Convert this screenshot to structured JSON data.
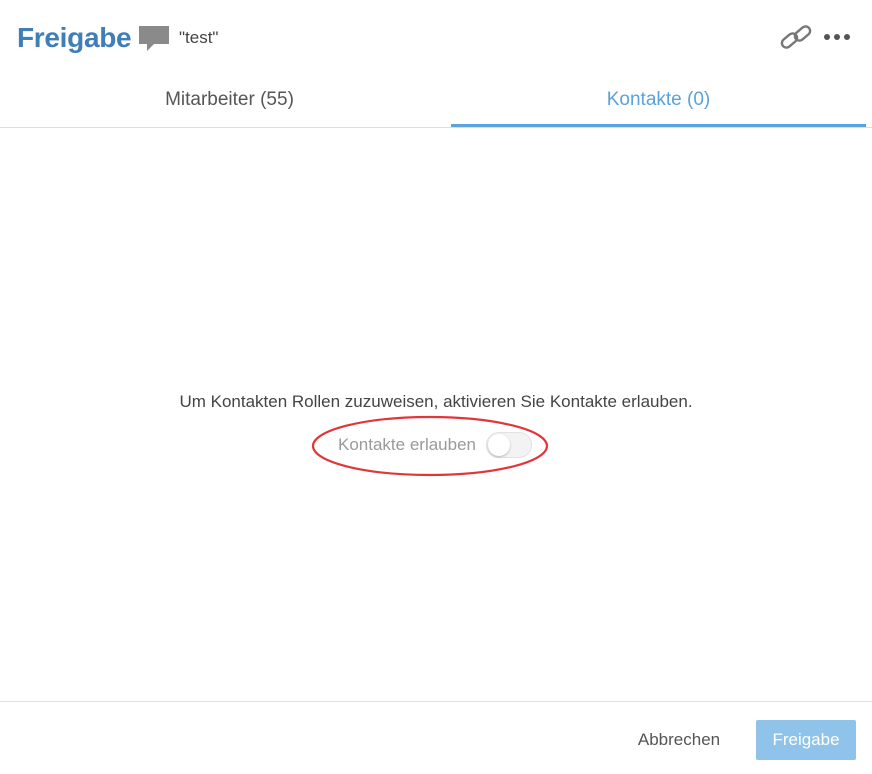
{
  "header": {
    "title": "Freigabe",
    "item_name": "\"test\"",
    "icons": {
      "item_type": "comment-icon",
      "share_link": "link-icon",
      "more": "more-dots-icon"
    }
  },
  "tabs": [
    {
      "label": "Mitarbeiter (55)",
      "active": false
    },
    {
      "label": "Kontakte (0)",
      "active": true
    }
  ],
  "main": {
    "message": "Um Kontakten Rollen zuzuweisen, aktivieren Sie Kontakte erlauben.",
    "toggle": {
      "label": "Kontakte erlauben",
      "enabled": false
    }
  },
  "footer": {
    "cancel_label": "Abbrechen",
    "share_label": "Freigabe"
  },
  "colors": {
    "title": "#3f7fb6",
    "accent": "#5aa3dc",
    "primary_button": "#8fc3ea",
    "highlight": "#e0363a"
  }
}
